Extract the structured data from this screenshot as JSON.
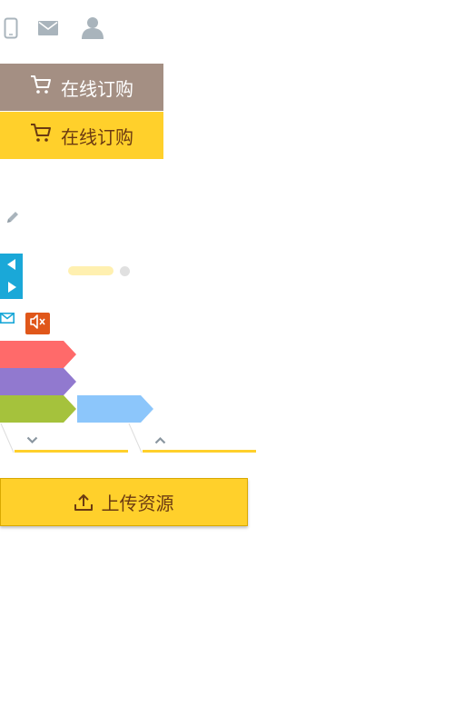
{
  "top_icons": [
    {
      "icon": "phone-icon"
    },
    {
      "icon": "mail-icon"
    },
    {
      "icon": "user-icon"
    }
  ],
  "order_buttons": {
    "hover_label": "在线订购",
    "normal_label": "在线订购",
    "icon": "cart-icon"
  },
  "colors": {
    "hover_bg": "#a48f83",
    "yellow": "#ffd02b",
    "brown_text": "#6b3a12",
    "slider_blue": "#1aa8d8",
    "sound_orange": "#e0571a",
    "tag_red": "#ff6a6a",
    "tag_purple": "#9179cf",
    "tag_green": "#a5c23c",
    "tag_blue": "#8cc6fb"
  },
  "slider": {
    "active_dot": 1,
    "dot_count": 2
  },
  "tags": [
    {
      "color": "#ff6a6a"
    },
    {
      "color": "#9179cf"
    },
    {
      "color": "#a5c23c"
    },
    {
      "color": "#8cc6fb"
    }
  ],
  "dropdown_tabs": [
    {
      "icon": "chevron-down-icon"
    },
    {
      "icon": "chevron-up-icon"
    }
  ],
  "upload": {
    "label": "上传资源",
    "icon": "upload-icon"
  }
}
